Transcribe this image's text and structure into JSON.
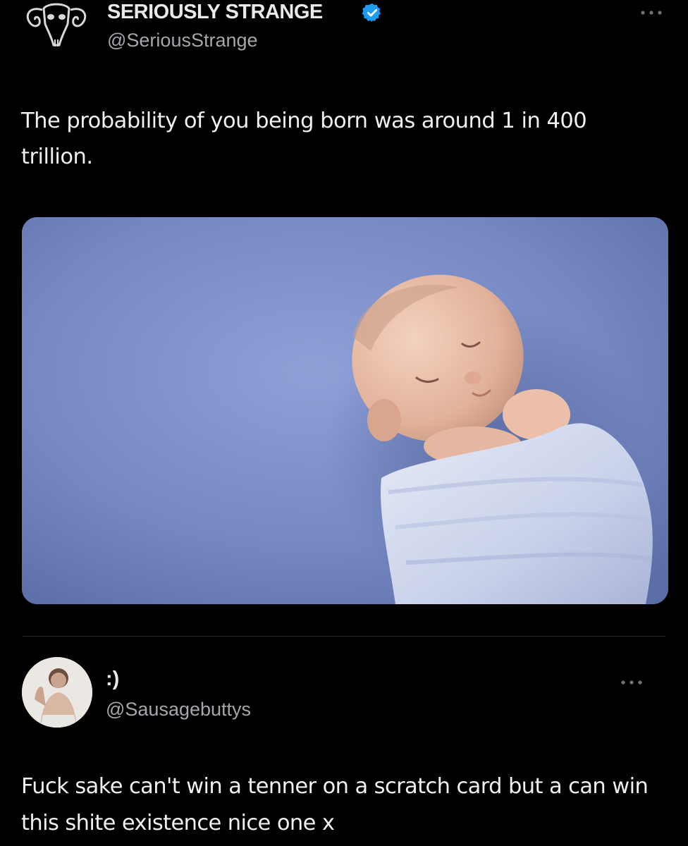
{
  "tweet": {
    "display_name": "SERIOUSLY STRANGE",
    "handle": "@SeriousStrange",
    "verified": true,
    "avatar_icon": "ram-skull-logo-icon",
    "more_icon": "more-horizontal-icon",
    "text": "The probability of you being born was around 1 in 400 trillion.",
    "media_icon": "sleeping-swaddled-baby-photo"
  },
  "reply": {
    "display_name": ":)",
    "handle": "@Sausagebuttys",
    "avatar_icon": "user-avatar-photo",
    "more_icon": "more-horizontal-icon",
    "text": "Fuck sake can't win a tenner on a scratch card but a can win this shite existence nice one x"
  },
  "colors": {
    "background": "#000000",
    "text_primary": "#e7e9ea",
    "text_secondary": "#a3a6ab",
    "verified_blue": "#1d9bf0",
    "divider": "#2a2d31"
  }
}
